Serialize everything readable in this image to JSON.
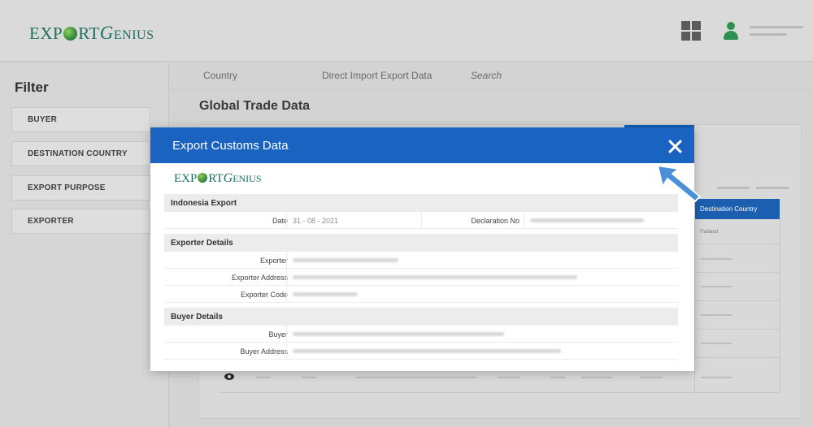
{
  "header": {
    "logo": {
      "part1": "EXP",
      "part2": "RT",
      "part3": "ENIUS",
      "g": "G"
    }
  },
  "sidebar": {
    "title": "Filter",
    "items": [
      {
        "label": "BUYER"
      },
      {
        "label": "DESTINATION COUNTRY"
      },
      {
        "label": "EXPORT PURPOSE"
      },
      {
        "label": "EXPORTER"
      }
    ]
  },
  "main": {
    "tabs": [
      {
        "label": "Country"
      },
      {
        "label": "Direct Import Export Data"
      },
      {
        "label": "Search"
      }
    ],
    "title": "Global Trade Data",
    "table": {
      "column_header": "Destination Country",
      "first_cell": "Thailand"
    }
  },
  "modal": {
    "title": "Export Customs Data",
    "sections": [
      {
        "heading": "Indonesia Export",
        "rows": [
          {
            "label": "Date",
            "value": "31 - 08 - 2021",
            "label2": "Declaration No"
          }
        ]
      },
      {
        "heading": "Exporter Details",
        "rows": [
          {
            "label": "Exporter"
          },
          {
            "label": "Exporter Address"
          },
          {
            "label": "Exporter Code"
          }
        ]
      },
      {
        "heading": "Buyer Details",
        "rows": [
          {
            "label": "Buyer"
          },
          {
            "label": "Buyer Address"
          }
        ]
      }
    ]
  },
  "colors": {
    "modal_header": "#1a63c1",
    "logo_green": "#1f6f5c",
    "user_icon": "#2f8f4f",
    "arrow": "#4a90d9"
  },
  "icons": [
    "grid-icon",
    "user-icon",
    "close-icon",
    "eye-icon",
    "pointer-arrow-icon",
    "globe-icon"
  ]
}
